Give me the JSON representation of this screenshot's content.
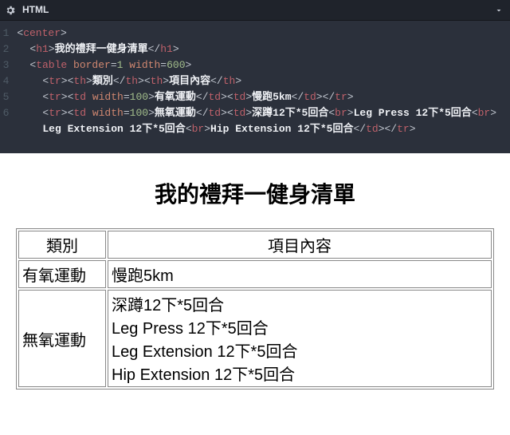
{
  "editor": {
    "panel_title": "HTML",
    "gutter": [
      "1",
      "2",
      "3",
      "4",
      "5",
      "6"
    ],
    "code_lines": [
      {
        "indent": 0,
        "segments": [
          {
            "t": "punct",
            "v": "<"
          },
          {
            "t": "tag",
            "v": "center"
          },
          {
            "t": "punct",
            "v": ">"
          }
        ]
      },
      {
        "indent": 1,
        "segments": [
          {
            "t": "punct",
            "v": "<"
          },
          {
            "t": "tag",
            "v": "h1"
          },
          {
            "t": "punct",
            "v": ">"
          },
          {
            "t": "txt",
            "v": "我的禮拜一健身清單"
          },
          {
            "t": "punct",
            "v": "</"
          },
          {
            "t": "tag",
            "v": "h1"
          },
          {
            "t": "punct",
            "v": ">"
          }
        ]
      },
      {
        "indent": 1,
        "segments": [
          {
            "t": "punct",
            "v": "<"
          },
          {
            "t": "tag",
            "v": "table"
          },
          {
            "t": "punct",
            "v": " "
          },
          {
            "t": "attr",
            "v": "border"
          },
          {
            "t": "punct",
            "v": "="
          },
          {
            "t": "val",
            "v": "1"
          },
          {
            "t": "punct",
            "v": " "
          },
          {
            "t": "attr",
            "v": "width"
          },
          {
            "t": "punct",
            "v": "="
          },
          {
            "t": "val",
            "v": "600"
          },
          {
            "t": "punct",
            "v": ">"
          }
        ]
      },
      {
        "indent": 2,
        "segments": [
          {
            "t": "punct",
            "v": "<"
          },
          {
            "t": "tag",
            "v": "tr"
          },
          {
            "t": "punct",
            "v": "><"
          },
          {
            "t": "tag",
            "v": "th"
          },
          {
            "t": "punct",
            "v": ">"
          },
          {
            "t": "txt",
            "v": "類別"
          },
          {
            "t": "punct",
            "v": "</"
          },
          {
            "t": "tag",
            "v": "th"
          },
          {
            "t": "punct",
            "v": "><"
          },
          {
            "t": "tag",
            "v": "th"
          },
          {
            "t": "punct",
            "v": ">"
          },
          {
            "t": "txt",
            "v": "項目內容"
          },
          {
            "t": "punct",
            "v": "</"
          },
          {
            "t": "tag",
            "v": "th"
          },
          {
            "t": "punct",
            "v": ">"
          }
        ]
      },
      {
        "indent": 2,
        "segments": [
          {
            "t": "punct",
            "v": "<"
          },
          {
            "t": "tag",
            "v": "tr"
          },
          {
            "t": "punct",
            "v": "><"
          },
          {
            "t": "tag",
            "v": "td"
          },
          {
            "t": "punct",
            "v": " "
          },
          {
            "t": "attr",
            "v": "width"
          },
          {
            "t": "punct",
            "v": "="
          },
          {
            "t": "val",
            "v": "100"
          },
          {
            "t": "punct",
            "v": ">"
          },
          {
            "t": "txt",
            "v": "有氧運動"
          },
          {
            "t": "punct",
            "v": "</"
          },
          {
            "t": "tag",
            "v": "td"
          },
          {
            "t": "punct",
            "v": "><"
          },
          {
            "t": "tag",
            "v": "td"
          },
          {
            "t": "punct",
            "v": ">"
          },
          {
            "t": "txt",
            "v": "慢跑5km"
          },
          {
            "t": "punct",
            "v": "</"
          },
          {
            "t": "tag",
            "v": "td"
          },
          {
            "t": "punct",
            "v": "></"
          },
          {
            "t": "tag",
            "v": "tr"
          },
          {
            "t": "punct",
            "v": ">"
          }
        ]
      },
      {
        "indent": 2,
        "segments": [
          {
            "t": "punct",
            "v": "<"
          },
          {
            "t": "tag",
            "v": "tr"
          },
          {
            "t": "punct",
            "v": "><"
          },
          {
            "t": "tag",
            "v": "td"
          },
          {
            "t": "punct",
            "v": " "
          },
          {
            "t": "attr",
            "v": "width"
          },
          {
            "t": "punct",
            "v": "="
          },
          {
            "t": "val",
            "v": "100"
          },
          {
            "t": "punct",
            "v": ">"
          },
          {
            "t": "txt",
            "v": "無氧運動"
          },
          {
            "t": "punct",
            "v": "</"
          },
          {
            "t": "tag",
            "v": "td"
          },
          {
            "t": "punct",
            "v": "><"
          },
          {
            "t": "tag",
            "v": "td"
          },
          {
            "t": "punct",
            "v": ">"
          },
          {
            "t": "txt",
            "v": "深蹲12下*5回合"
          },
          {
            "t": "punct",
            "v": "<"
          },
          {
            "t": "tag",
            "v": "br"
          },
          {
            "t": "punct",
            "v": ">"
          },
          {
            "t": "txt",
            "v": "Leg Press 12下*5回合"
          },
          {
            "t": "punct",
            "v": "<"
          },
          {
            "t": "tag",
            "v": "br"
          },
          {
            "t": "punct",
            "v": ">"
          },
          {
            "t": "txt",
            "v": "Leg Extension 12下*5回合"
          },
          {
            "t": "punct",
            "v": "<"
          },
          {
            "t": "tag",
            "v": "br"
          },
          {
            "t": "punct",
            "v": ">"
          },
          {
            "t": "txt",
            "v": "Hip Extension 12下*5回合"
          },
          {
            "t": "punct",
            "v": "</"
          },
          {
            "t": "tag",
            "v": "td"
          },
          {
            "t": "punct",
            "v": "></"
          },
          {
            "t": "tag",
            "v": "tr"
          },
          {
            "t": "punct",
            "v": ">"
          }
        ]
      }
    ]
  },
  "preview": {
    "heading": "我的禮拜一健身清單",
    "table": {
      "headers": [
        "類別",
        "項目內容"
      ],
      "rows": [
        {
          "c0": "有氧運動",
          "c1": "慢跑5km"
        },
        {
          "c0": "無氧運動",
          "c1": "深蹲12下*5回合\nLeg Press 12下*5回合\nLeg Extension 12下*5回合\nHip Extension 12下*5回合"
        }
      ]
    }
  }
}
